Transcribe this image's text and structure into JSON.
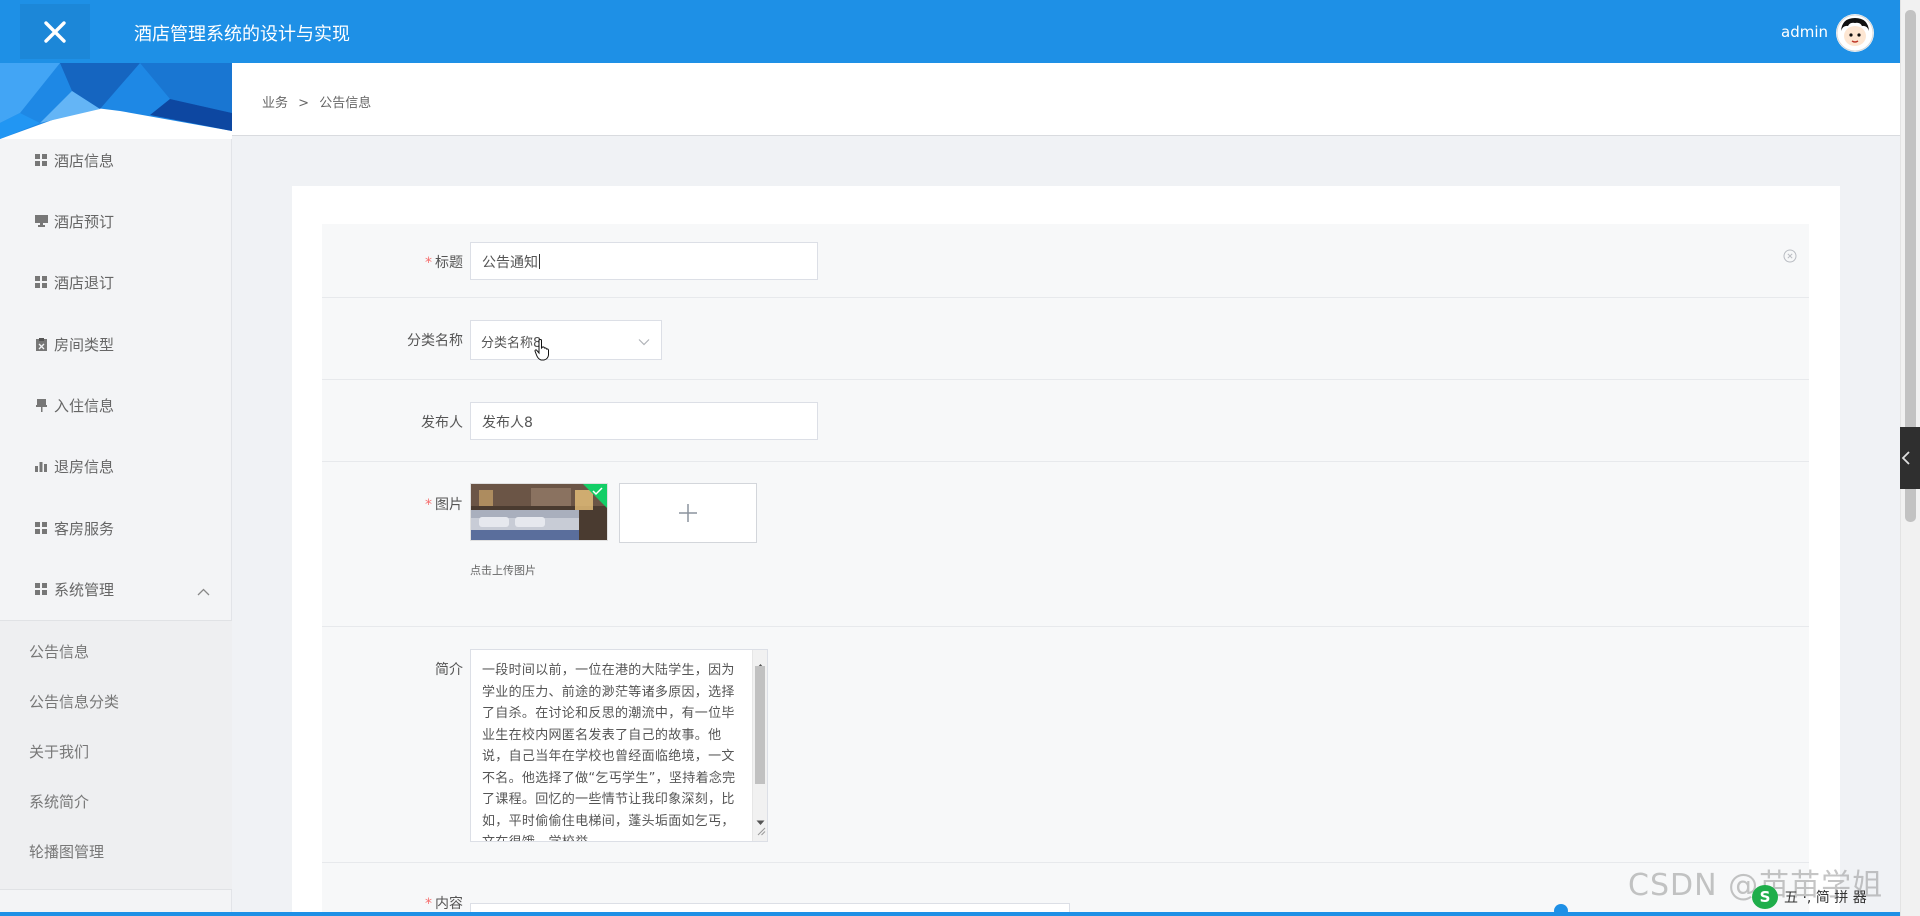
{
  "header": {
    "title": "酒店管理系统的设计与实现",
    "user": "admin"
  },
  "breadcrumb": {
    "parent": "业务",
    "separator": ">",
    "current": "公告信息"
  },
  "sidebar": {
    "items": [
      {
        "label": "酒店信息",
        "icon": "grid-icon"
      },
      {
        "label": "酒店预订",
        "icon": "monitor-icon"
      },
      {
        "label": "酒店退订",
        "icon": "grid-icon"
      },
      {
        "label": "房间类型",
        "icon": "clipboard-icon"
      },
      {
        "label": "入住信息",
        "icon": "pushpin-icon"
      },
      {
        "label": "退房信息",
        "icon": "bar-chart-icon"
      },
      {
        "label": "客房服务",
        "icon": "grid-icon"
      },
      {
        "label": "系统管理",
        "icon": "grid-icon",
        "expanded": true
      }
    ],
    "submenu": [
      "公告信息",
      "公告信息分类",
      "关于我们",
      "系统简介",
      "轮播图管理"
    ]
  },
  "form": {
    "title": {
      "label": "标题",
      "required": true,
      "value": "公告通知"
    },
    "category": {
      "label": "分类名称",
      "value": "分类名称8"
    },
    "publisher": {
      "label": "发布人",
      "value": "发布人8"
    },
    "image": {
      "label": "图片",
      "required": true,
      "tip": "点击上传图片"
    },
    "summary": {
      "label": "简介",
      "value": "一段时间以前，一位在港的大陆学生，因为学业的压力、前途的渺茫等诸多原因，选择了自杀。在讨论和反思的潮流中，有一位毕业生在校内网匿名发表了自己的故事。他说，自己当年在学校也曾经面临绝境，一文不名。他选择了做“乞丐学生”，坚持着念完了课程。回忆的一些情节让我印象深刻，比如，平时偷偷住电梯间，蓬头垢面如乞丐，文在很饿，学校举"
    },
    "content": {
      "label": "内容",
      "required": true
    }
  },
  "watermark": "CSDN @苗苗学姐",
  "ime": {
    "logo": "S",
    "glyphs": "五 ·, 简 拼 器"
  },
  "colors": {
    "primary": "#1e90e6",
    "required": "#f56c6c",
    "sidebar_bg": "#f3f4f6",
    "main_bg": "#f0f2f5"
  }
}
